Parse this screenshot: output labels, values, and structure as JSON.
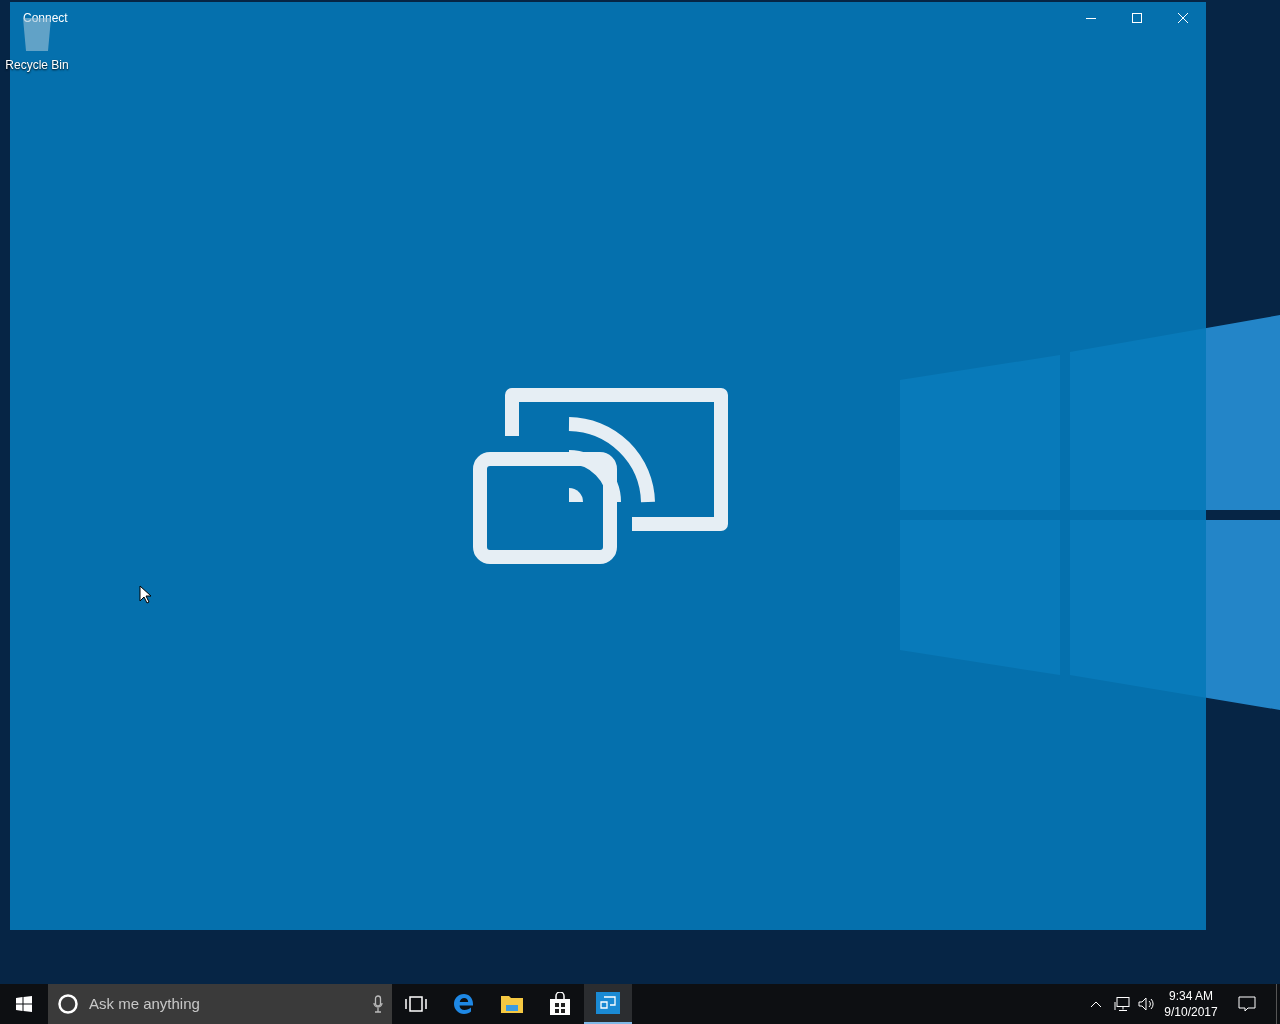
{
  "desktop": {
    "icons": [
      {
        "label": "Recycle Bin"
      }
    ]
  },
  "window": {
    "title": "Connect"
  },
  "taskbar": {
    "search": {
      "placeholder": "Ask me anything"
    },
    "apps": [
      {
        "kind": "taskview",
        "selected": false
      },
      {
        "kind": "edge",
        "selected": false
      },
      {
        "kind": "explorer",
        "selected": false
      },
      {
        "kind": "store",
        "selected": false
      },
      {
        "kind": "connect",
        "selected": true
      }
    ],
    "clock": {
      "time": "9:34 AM",
      "date": "9/10/2017"
    }
  }
}
